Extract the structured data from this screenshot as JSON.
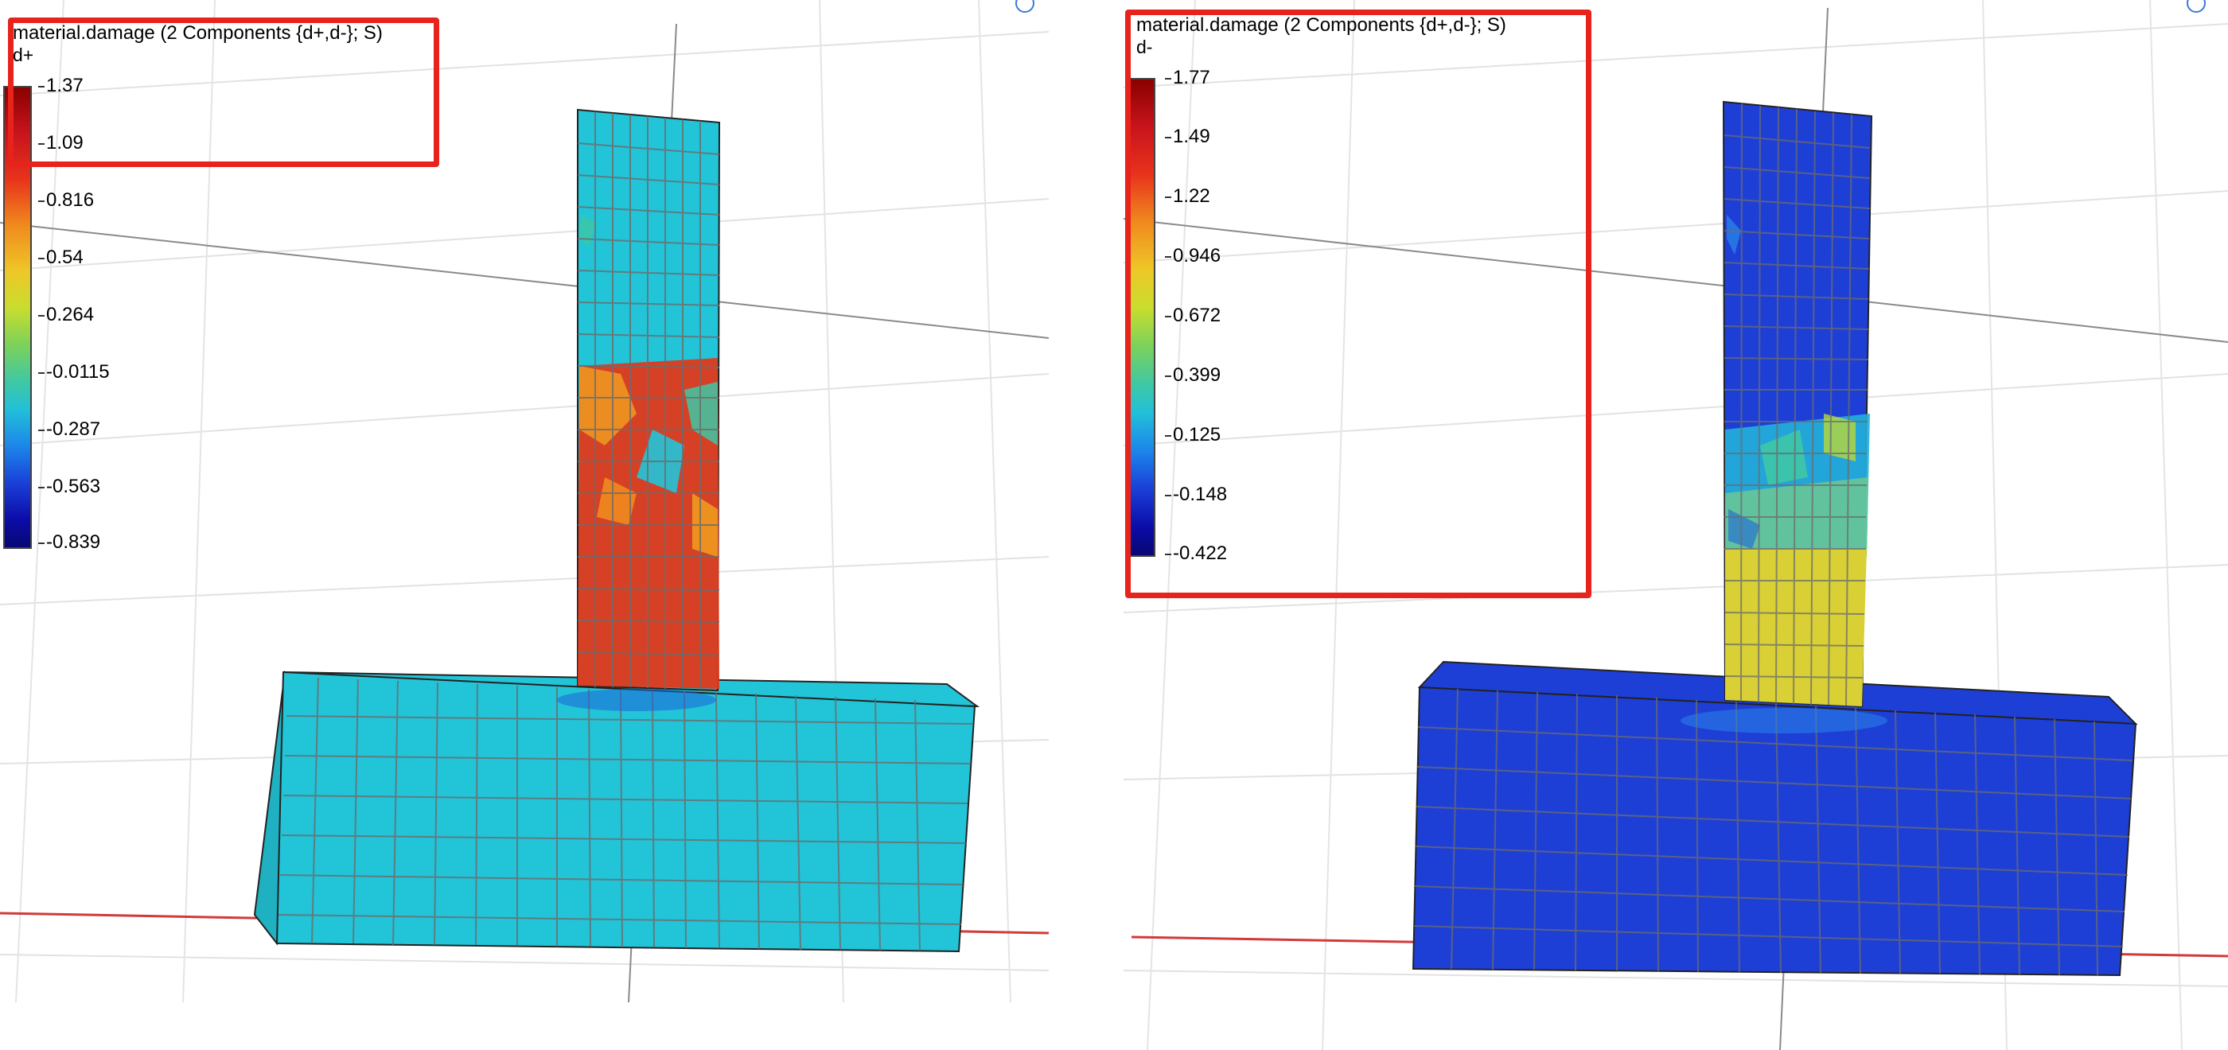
{
  "panels": [
    {
      "legend_title": "material.damage (2 Components {d+,d-}; S)",
      "component": "d+",
      "ticks": [
        "1.37",
        "1.09",
        "0.816",
        "0.54",
        "0.264",
        "-0.0115",
        "-0.287",
        "-0.563",
        "-0.839"
      ],
      "column_color": "#22c4d8",
      "base_color": "#22c4d8"
    },
    {
      "legend_title": "material.damage (2 Components {d+,d-}; S)",
      "component": "d-",
      "ticks": [
        "1.77",
        "1.49",
        "1.22",
        "0.946",
        "0.672",
        "0.399",
        "0.125",
        "-0.148",
        "-0.422"
      ],
      "column_color": "#1e3fd6",
      "base_color": "#1e3fd6"
    }
  ],
  "colors": {
    "highlight": "#e8231c",
    "mesh_line": "#7a7a7a",
    "damage_high_plus": "#e03a1c",
    "damage_high_minus": "#d8d034"
  }
}
